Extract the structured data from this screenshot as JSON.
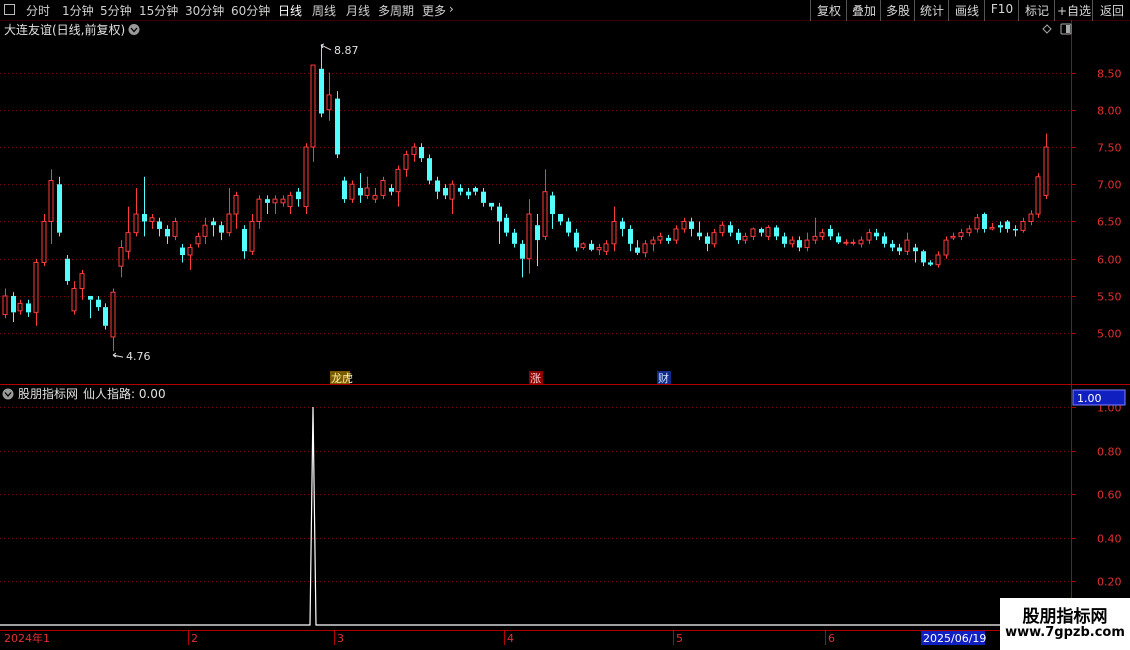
{
  "toolbar": {
    "period_tabs": [
      "分时",
      "1分钟",
      "5分钟",
      "15分钟",
      "30分钟",
      "60分钟",
      "日线",
      "周线",
      "月线",
      "多周期",
      "更多"
    ],
    "right_buttons": [
      "复权",
      "叠加",
      "多股",
      "统计",
      "画线",
      "F10",
      "标记",
      "+自选",
      "返回"
    ]
  },
  "main_panel": {
    "title": "大连友谊(日线,前复权)",
    "markers": [
      "龙虎",
      "涨",
      "财"
    ]
  },
  "indicator_panel": {
    "title": "股朋指标网",
    "line_label": "仙人指路: 0.00",
    "current_value": "1.00"
  },
  "watermark": {
    "line1": "股朋指标网",
    "line2": "www.7gpzb.com"
  },
  "timeline": {
    "labels": [
      "2024年1",
      "2",
      "3",
      "4",
      "5",
      "6"
    ],
    "current_date": "2025/06/19"
  },
  "chart_data": [
    {
      "type": "candlestick",
      "y_axis": {
        "ticks": [
          "8.50",
          "8.00",
          "7.50",
          "7.00",
          "6.50",
          "6.00",
          "5.50",
          "5.00"
        ],
        "range": [
          4.6,
          8.95
        ]
      },
      "high_label": "8.87",
      "low_label": "4.76",
      "colors": {
        "up": "#ff3c3c",
        "down": "#54ffff"
      },
      "candles": [
        [
          5.25,
          5.5,
          5.2,
          5.6
        ],
        [
          5.5,
          5.28,
          5.15,
          5.55
        ],
        [
          5.3,
          5.4,
          5.25,
          5.45
        ],
        [
          5.4,
          5.28,
          5.22,
          5.45
        ],
        [
          5.28,
          5.95,
          5.1,
          6.0
        ],
        [
          5.95,
          6.5,
          5.9,
          6.6
        ],
        [
          6.5,
          7.05,
          6.2,
          7.2
        ],
        [
          7.0,
          6.35,
          6.3,
          7.1
        ],
        [
          6.0,
          5.7,
          5.65,
          6.05
        ],
        [
          5.3,
          5.6,
          5.25,
          5.7
        ],
        [
          5.6,
          5.8,
          5.45,
          5.85
        ],
        [
          5.5,
          5.45,
          5.2,
          5.5
        ],
        [
          5.45,
          5.35,
          5.3,
          5.5
        ],
        [
          5.35,
          5.1,
          5.05,
          5.4
        ],
        [
          4.95,
          5.55,
          4.76,
          5.6
        ],
        [
          5.9,
          6.15,
          5.75,
          6.25
        ],
        [
          6.1,
          6.35,
          6.0,
          6.7
        ],
        [
          6.35,
          6.6,
          6.3,
          6.95
        ],
        [
          6.6,
          6.5,
          6.3,
          7.1
        ],
        [
          6.5,
          6.55,
          6.4,
          6.6
        ],
        [
          6.5,
          6.4,
          6.3,
          6.55
        ],
        [
          6.4,
          6.3,
          6.2,
          6.45
        ],
        [
          6.3,
          6.5,
          6.25,
          6.55
        ],
        [
          6.15,
          6.05,
          5.95,
          6.2
        ],
        [
          6.05,
          6.15,
          5.85,
          6.2
        ],
        [
          6.2,
          6.3,
          6.15,
          6.35
        ],
        [
          6.3,
          6.45,
          6.2,
          6.55
        ],
        [
          6.5,
          6.45,
          6.3,
          6.55
        ],
        [
          6.45,
          6.35,
          6.25,
          6.5
        ],
        [
          6.35,
          6.6,
          6.3,
          6.95
        ],
        [
          6.6,
          6.85,
          6.4,
          6.9
        ],
        [
          6.4,
          6.1,
          6.0,
          6.45
        ],
        [
          6.1,
          6.5,
          6.05,
          6.6
        ],
        [
          6.5,
          6.8,
          6.4,
          6.85
        ],
        [
          6.8,
          6.75,
          6.6,
          6.85
        ],
        [
          6.75,
          6.8,
          6.6,
          6.85
        ],
        [
          6.75,
          6.8,
          6.7,
          6.85
        ],
        [
          6.7,
          6.85,
          6.6,
          6.9
        ],
        [
          6.9,
          6.8,
          6.7,
          6.95
        ],
        [
          6.7,
          7.5,
          6.6,
          7.55
        ],
        [
          7.5,
          8.6,
          7.3,
          8.6
        ],
        [
          8.55,
          7.95,
          7.9,
          8.87
        ],
        [
          8.0,
          8.2,
          7.85,
          8.5
        ],
        [
          8.15,
          7.4,
          7.35,
          8.25
        ],
        [
          7.05,
          6.8,
          6.75,
          7.1
        ],
        [
          6.8,
          7.0,
          6.75,
          7.05
        ],
        [
          6.95,
          6.85,
          6.75,
          7.15
        ],
        [
          6.85,
          6.95,
          6.8,
          7.1
        ],
        [
          6.8,
          6.85,
          6.75,
          6.95
        ],
        [
          6.85,
          7.05,
          6.8,
          7.1
        ],
        [
          6.95,
          6.9,
          6.85,
          7.0
        ],
        [
          6.9,
          7.2,
          6.7,
          7.25
        ],
        [
          7.2,
          7.4,
          7.1,
          7.45
        ],
        [
          7.4,
          7.5,
          7.3,
          7.55
        ],
        [
          7.5,
          7.35,
          7.3,
          7.55
        ],
        [
          7.35,
          7.05,
          7.0,
          7.4
        ],
        [
          7.05,
          6.9,
          6.8,
          7.1
        ],
        [
          6.95,
          6.85,
          6.8,
          7.0
        ],
        [
          6.8,
          7.0,
          6.6,
          7.05
        ],
        [
          6.95,
          6.9,
          6.85,
          7.0
        ],
        [
          6.9,
          6.85,
          6.8,
          6.95
        ],
        [
          6.95,
          6.9,
          6.85,
          6.97
        ],
        [
          6.9,
          6.75,
          6.7,
          6.95
        ],
        [
          6.75,
          6.7,
          6.65,
          6.75
        ],
        [
          6.7,
          6.5,
          6.2,
          6.75
        ],
        [
          6.55,
          6.35,
          6.3,
          6.6
        ],
        [
          6.35,
          6.2,
          6.15,
          6.4
        ],
        [
          6.2,
          6.0,
          5.75,
          6.25
        ],
        [
          6.0,
          6.6,
          5.8,
          6.8
        ],
        [
          6.45,
          6.25,
          5.9,
          6.6
        ],
        [
          6.3,
          6.9,
          6.25,
          7.2
        ],
        [
          6.85,
          6.6,
          6.4,
          6.9
        ],
        [
          6.6,
          6.5,
          6.45,
          6.6
        ],
        [
          6.5,
          6.35,
          6.3,
          6.55
        ],
        [
          6.35,
          6.15,
          6.1,
          6.4
        ],
        [
          6.15,
          6.2,
          6.12,
          6.22
        ],
        [
          6.2,
          6.12,
          6.1,
          6.25
        ],
        [
          6.12,
          6.15,
          6.05,
          6.2
        ],
        [
          6.1,
          6.2,
          6.05,
          6.25
        ],
        [
          6.2,
          6.5,
          6.1,
          6.7
        ],
        [
          6.5,
          6.4,
          6.3,
          6.55
        ],
        [
          6.4,
          6.2,
          6.1,
          6.45
        ],
        [
          6.15,
          6.08,
          6.05,
          6.25
        ],
        [
          6.08,
          6.2,
          6.02,
          6.25
        ],
        [
          6.2,
          6.25,
          6.1,
          6.3
        ],
        [
          6.25,
          6.3,
          6.2,
          6.35
        ],
        [
          6.28,
          6.24,
          6.2,
          6.32
        ],
        [
          6.25,
          6.4,
          6.2,
          6.45
        ],
        [
          6.4,
          6.5,
          6.35,
          6.55
        ],
        [
          6.5,
          6.4,
          6.3,
          6.55
        ],
        [
          6.35,
          6.3,
          6.25,
          6.5
        ],
        [
          6.3,
          6.2,
          6.1,
          6.35
        ],
        [
          6.2,
          6.35,
          6.15,
          6.4
        ],
        [
          6.35,
          6.45,
          6.3,
          6.5
        ],
        [
          6.45,
          6.35,
          6.3,
          6.5
        ],
        [
          6.35,
          6.25,
          6.2,
          6.4
        ],
        [
          6.25,
          6.3,
          6.2,
          6.35
        ],
        [
          6.3,
          6.4,
          6.25,
          6.42
        ],
        [
          6.4,
          6.35,
          6.3,
          6.42
        ],
        [
          6.3,
          6.42,
          6.25,
          6.45
        ],
        [
          6.42,
          6.3,
          6.25,
          6.45
        ],
        [
          6.3,
          6.2,
          6.15,
          6.35
        ],
        [
          6.2,
          6.25,
          6.15,
          6.3
        ],
        [
          6.25,
          6.15,
          6.1,
          6.3
        ],
        [
          6.15,
          6.25,
          6.1,
          6.35
        ],
        [
          6.25,
          6.3,
          6.2,
          6.55
        ],
        [
          6.3,
          6.35,
          6.25,
          6.4
        ],
        [
          6.4,
          6.3,
          6.25,
          6.45
        ],
        [
          6.3,
          6.22,
          6.2,
          6.35
        ],
        [
          6.22,
          6.22,
          6.18,
          6.26
        ],
        [
          6.22,
          6.22,
          6.18,
          6.26
        ],
        [
          6.2,
          6.25,
          6.15,
          6.3
        ],
        [
          6.25,
          6.35,
          6.2,
          6.4
        ],
        [
          6.35,
          6.3,
          6.25,
          6.4
        ],
        [
          6.3,
          6.2,
          6.15,
          6.35
        ],
        [
          6.2,
          6.15,
          6.1,
          6.25
        ],
        [
          6.15,
          6.1,
          6.05,
          6.2
        ],
        [
          6.1,
          6.25,
          6.05,
          6.35
        ],
        [
          6.15,
          6.1,
          5.95,
          6.2
        ],
        [
          6.1,
          5.95,
          5.9,
          6.12
        ],
        [
          5.95,
          5.92,
          5.9,
          5.98
        ],
        [
          5.92,
          6.05,
          5.88,
          6.1
        ],
        [
          6.05,
          6.25,
          6.0,
          6.3
        ],
        [
          6.28,
          6.3,
          6.25,
          6.35
        ],
        [
          6.3,
          6.35,
          6.25,
          6.4
        ],
        [
          6.35,
          6.4,
          6.3,
          6.45
        ],
        [
          6.4,
          6.55,
          6.35,
          6.6
        ],
        [
          6.6,
          6.4,
          6.35,
          6.62
        ],
        [
          6.4,
          6.42,
          6.38,
          6.48
        ],
        [
          6.45,
          6.42,
          6.35,
          6.5
        ],
        [
          6.5,
          6.4,
          6.35,
          6.52
        ],
        [
          6.4,
          6.38,
          6.3,
          6.45
        ],
        [
          6.38,
          6.5,
          6.35,
          6.55
        ],
        [
          6.5,
          6.6,
          6.45,
          6.65
        ],
        [
          6.6,
          7.1,
          6.55,
          7.15
        ],
        [
          6.85,
          7.5,
          6.8,
          7.68
        ]
      ]
    },
    {
      "type": "line",
      "y_axis": {
        "ticks": [
          "1.00",
          "0.80",
          "0.60",
          "0.40",
          "0.20"
        ],
        "range": [
          0,
          1.05
        ]
      },
      "spike_index": 40,
      "spike_value": 1.0,
      "color": "#ffffff"
    }
  ]
}
